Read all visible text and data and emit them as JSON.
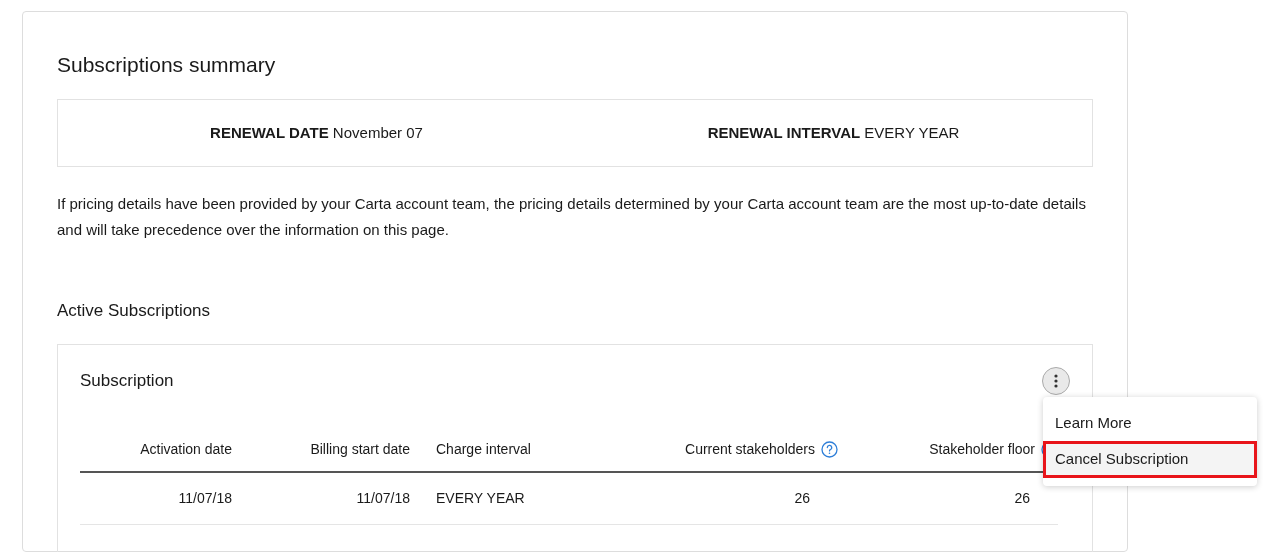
{
  "summary": {
    "title": "Subscriptions summary",
    "fields": [
      {
        "label": "RENEWAL DATE",
        "value": "November 07"
      },
      {
        "label": "RENEWAL INTERVAL",
        "value": "EVERY YEAR"
      }
    ],
    "notice": "If pricing details have been provided by your Carta account team, the pricing details determined by your Carta account team are the most up-to-date details and will take precedence over the information on this page."
  },
  "active_subscriptions": {
    "heading": "Active Subscriptions",
    "subscription": {
      "title": "Subscription",
      "menu": [
        {
          "label": "Learn More",
          "highlighted": false
        },
        {
          "label": "Cancel Subscription",
          "highlighted": true
        }
      ],
      "table": {
        "columns": [
          {
            "label": "Activation date",
            "help": false
          },
          {
            "label": "Billing start date",
            "help": false
          },
          {
            "label": "Charge interval",
            "help": false
          },
          {
            "label": "Current stakeholders",
            "help": true
          },
          {
            "label": "Stakeholder floor",
            "help": true
          }
        ],
        "rows": [
          [
            "11/07/18",
            "11/07/18",
            "EVERY YEAR",
            "26",
            "26"
          ]
        ]
      }
    }
  }
}
